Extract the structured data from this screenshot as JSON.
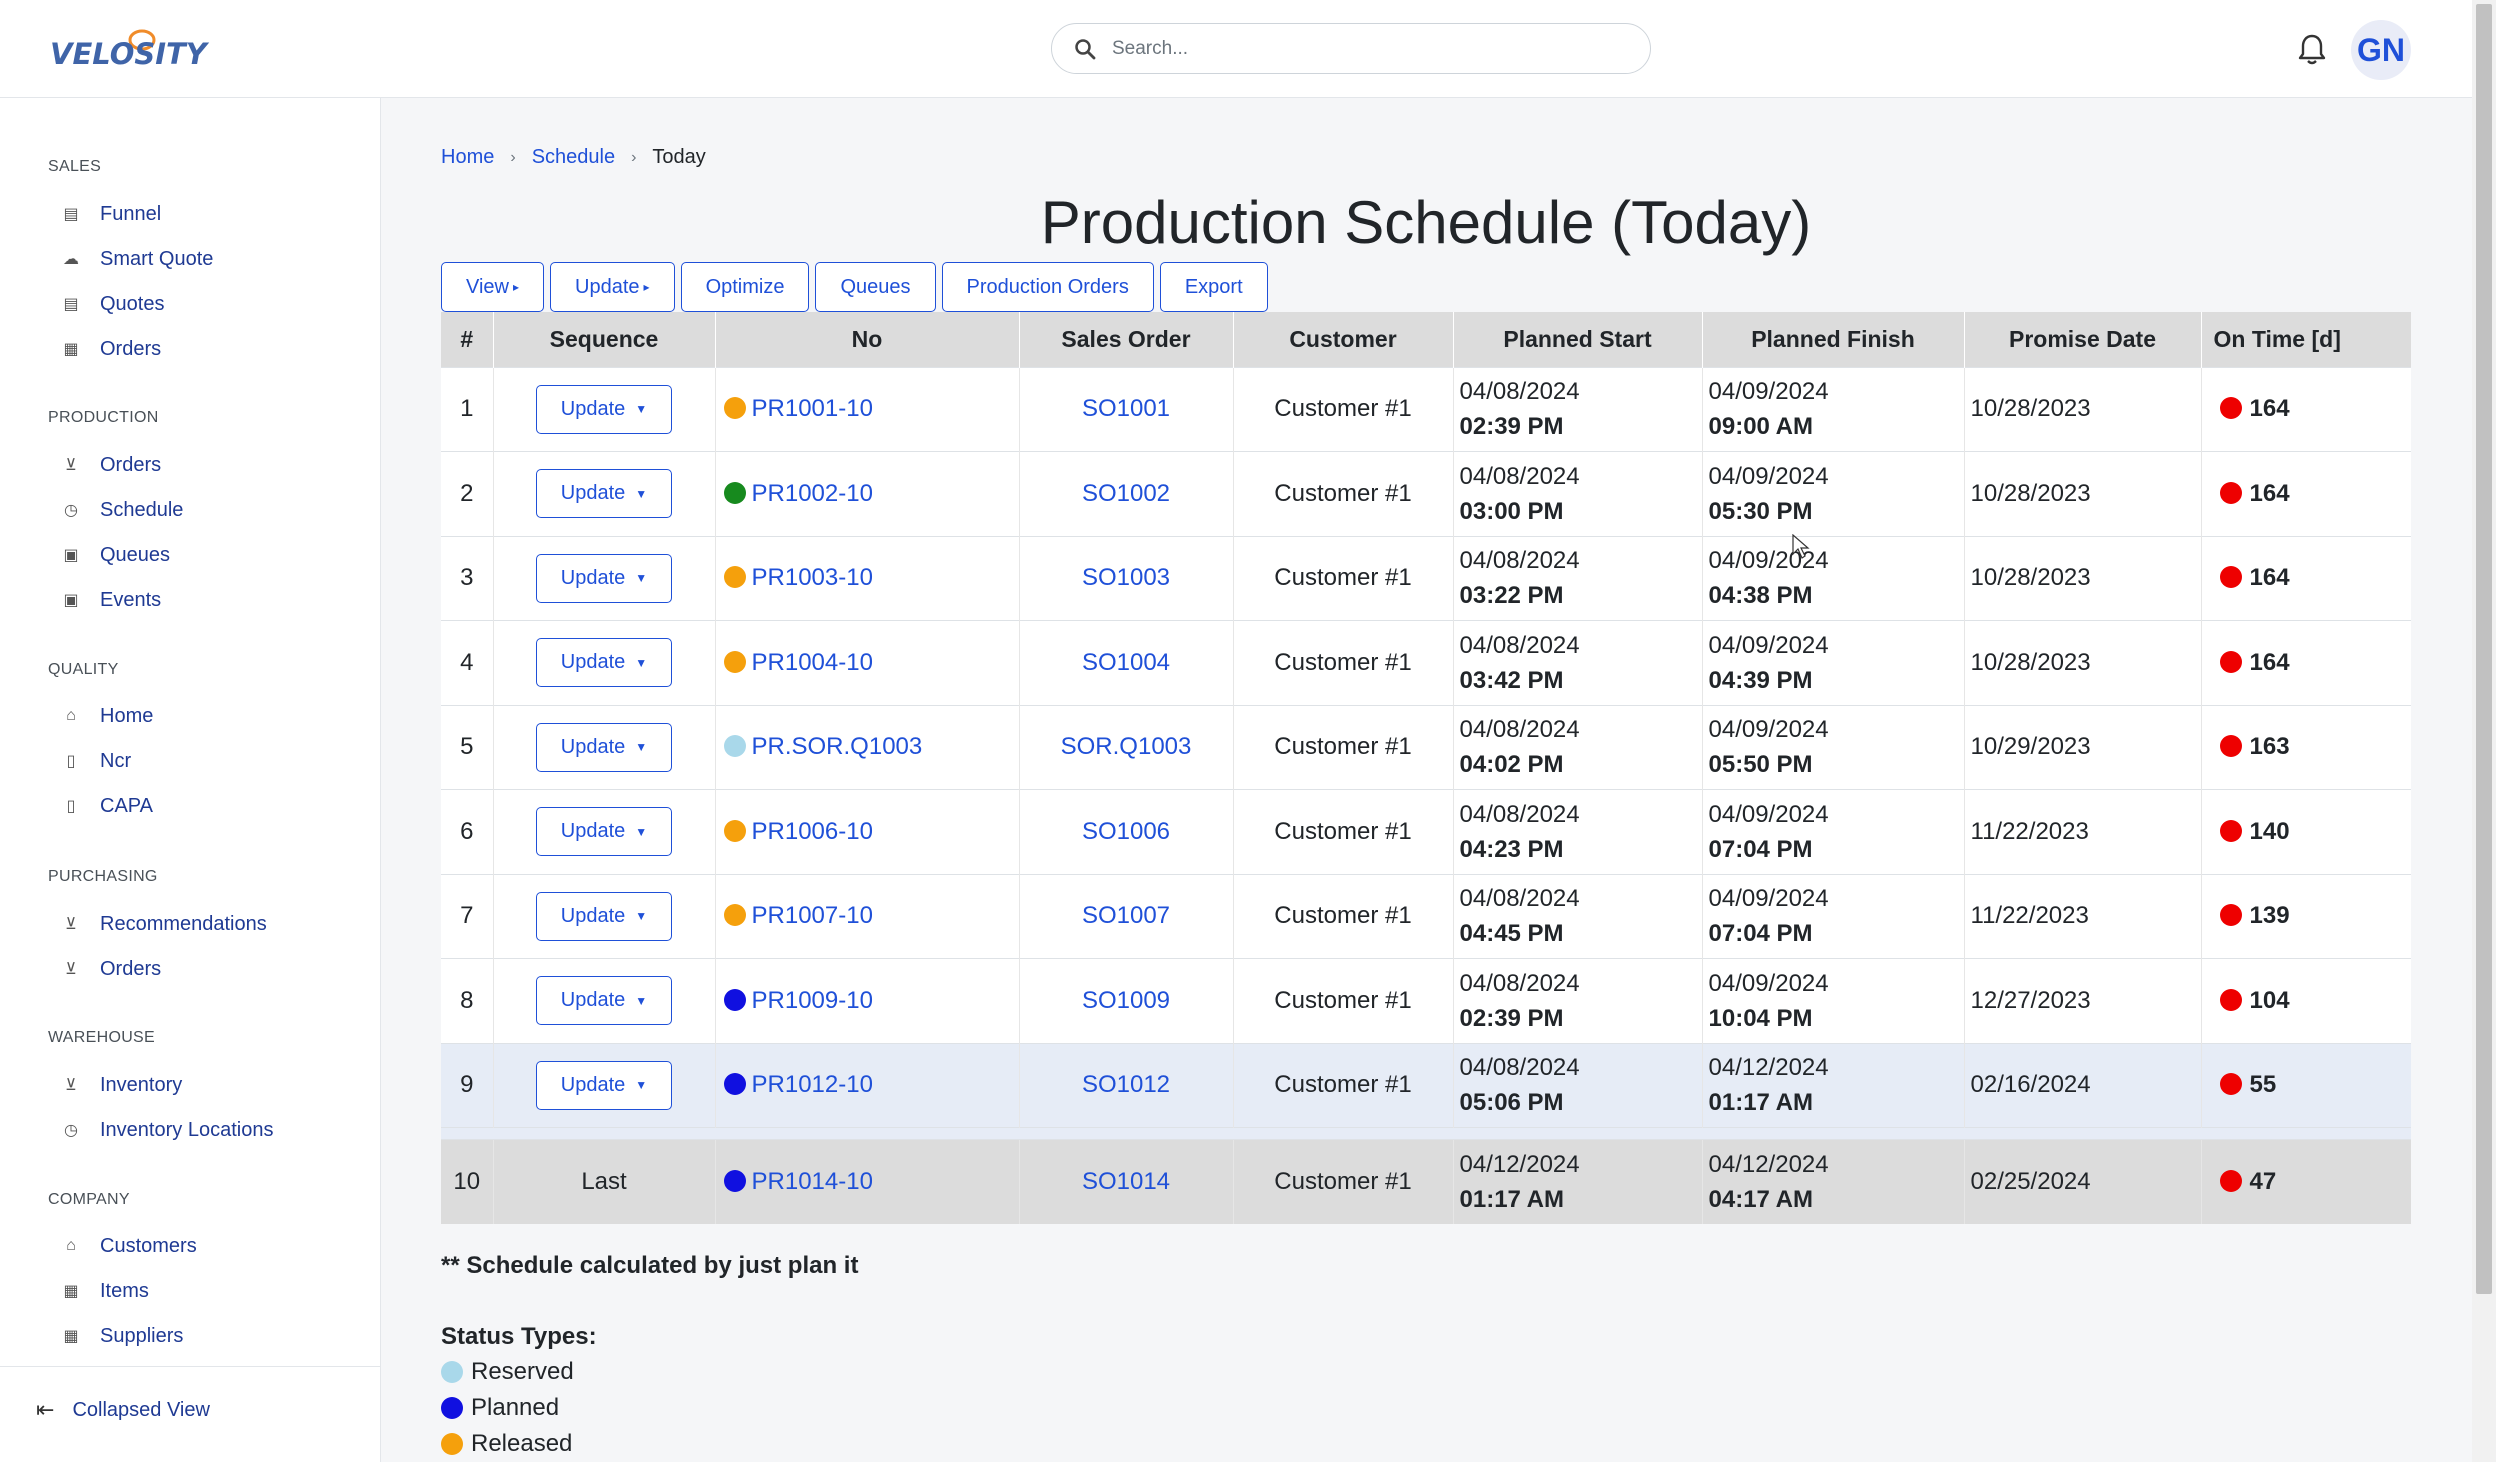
{
  "brand": {
    "logo_text": "VELOSITY",
    "accent": "#1f50d8"
  },
  "header": {
    "search_placeholder": "Search...",
    "avatar_initials": "GN"
  },
  "sidebar": {
    "sections": [
      {
        "title": "SALES",
        "items": [
          "Funnel",
          "Smart Quote",
          "Quotes",
          "Orders"
        ]
      },
      {
        "title": "PRODUCTION",
        "items": [
          "Orders",
          "Schedule",
          "Queues",
          "Events"
        ]
      },
      {
        "title": "QUALITY",
        "items": [
          "Home",
          "Ncr",
          "CAPA"
        ]
      },
      {
        "title": "PURCHASING",
        "items": [
          "Recommendations",
          "Orders"
        ]
      },
      {
        "title": "WAREHOUSE",
        "items": [
          "Inventory",
          "Inventory Locations"
        ]
      },
      {
        "title": "COMPANY",
        "items": [
          "Customers",
          "Items",
          "Suppliers"
        ]
      }
    ],
    "collapse_label": "Collapsed View"
  },
  "breadcrumb": [
    "Home",
    "Schedule",
    "Today"
  ],
  "page_title": "Production Schedule (Today)",
  "toolbar": {
    "view": "View",
    "update": "Update",
    "optimize": "Optimize",
    "queues": "Queues",
    "production_orders": "Production Orders",
    "export": "Export"
  },
  "table": {
    "headers": [
      "#",
      "Sequence",
      "No",
      "Sales Order",
      "Customer",
      "Planned Start",
      "Planned Finish",
      "Promise Date",
      "On Time [d]"
    ],
    "update_label": "Update",
    "last_label": "Last",
    "rows": [
      {
        "n": "1",
        "status_color": "#f5a00c",
        "no": "PR1001-10",
        "so": "SO1001",
        "customer": "Customer #1",
        "ps_date": "04/08/2024",
        "ps_time": "02:39 PM",
        "pf_date": "04/09/2024",
        "pf_time": "09:00 AM",
        "promise": "10/28/2023",
        "ontime": "164"
      },
      {
        "n": "2",
        "status_color": "#178a1e",
        "no": "PR1002-10",
        "so": "SO1002",
        "customer": "Customer #1",
        "ps_date": "04/08/2024",
        "ps_time": "03:00 PM",
        "pf_date": "04/09/2024",
        "pf_time": "05:30 PM",
        "promise": "10/28/2023",
        "ontime": "164"
      },
      {
        "n": "3",
        "status_color": "#f5a00c",
        "no": "PR1003-10",
        "so": "SO1003",
        "customer": "Customer #1",
        "ps_date": "04/08/2024",
        "ps_time": "03:22 PM",
        "pf_date": "04/09/2024",
        "pf_time": "04:38 PM",
        "promise": "10/28/2023",
        "ontime": "164"
      },
      {
        "n": "4",
        "status_color": "#f5a00c",
        "no": "PR1004-10",
        "so": "SO1004",
        "customer": "Customer #1",
        "ps_date": "04/08/2024",
        "ps_time": "03:42 PM",
        "pf_date": "04/09/2024",
        "pf_time": "04:39 PM",
        "promise": "10/28/2023",
        "ontime": "164"
      },
      {
        "n": "5",
        "status_color": "#a9d8ea",
        "no": "PR.SOR.Q1003",
        "so": "SOR.Q1003",
        "customer": "Customer #1",
        "ps_date": "04/08/2024",
        "ps_time": "04:02 PM",
        "pf_date": "04/09/2024",
        "pf_time": "05:50 PM",
        "promise": "10/29/2023",
        "ontime": "163"
      },
      {
        "n": "6",
        "status_color": "#f5a00c",
        "no": "PR1006-10",
        "so": "SO1006",
        "customer": "Customer #1",
        "ps_date": "04/08/2024",
        "ps_time": "04:23 PM",
        "pf_date": "04/09/2024",
        "pf_time": "07:04 PM",
        "promise": "11/22/2023",
        "ontime": "140"
      },
      {
        "n": "7",
        "status_color": "#f5a00c",
        "no": "PR1007-10",
        "so": "SO1007",
        "customer": "Customer #1",
        "ps_date": "04/08/2024",
        "ps_time": "04:45 PM",
        "pf_date": "04/09/2024",
        "pf_time": "07:04 PM",
        "promise": "11/22/2023",
        "ontime": "139"
      },
      {
        "n": "8",
        "status_color": "#1010e0",
        "no": "PR1009-10",
        "so": "SO1009",
        "customer": "Customer #1",
        "ps_date": "04/08/2024",
        "ps_time": "02:39 PM",
        "pf_date": "04/09/2024",
        "pf_time": "10:04 PM",
        "promise": "12/27/2023",
        "ontime": "104"
      },
      {
        "n": "9",
        "status_color": "#1010e0",
        "no": "PR1012-10",
        "so": "SO1012",
        "customer": "Customer #1",
        "ps_date": "04/08/2024",
        "ps_time": "05:06 PM",
        "pf_date": "04/12/2024",
        "pf_time": "01:17 AM",
        "promise": "02/16/2024",
        "ontime": "55"
      },
      {
        "n": "10",
        "status_color": "#1010e0",
        "no": "PR1014-10",
        "so": "SO1014",
        "customer": "Customer #1",
        "ps_date": "04/12/2024",
        "ps_time": "01:17 AM",
        "pf_date": "04/12/2024",
        "pf_time": "04:17 AM",
        "promise": "02/25/2024",
        "ontime": "47"
      }
    ]
  },
  "note": "** Schedule calculated by just plan it",
  "legend": {
    "title": "Status Types:",
    "items": [
      {
        "label": "Reserved",
        "color": "#a9d8ea"
      },
      {
        "label": "Planned",
        "color": "#1010e0"
      },
      {
        "label": "Released",
        "color": "#f5a00c"
      }
    ]
  }
}
